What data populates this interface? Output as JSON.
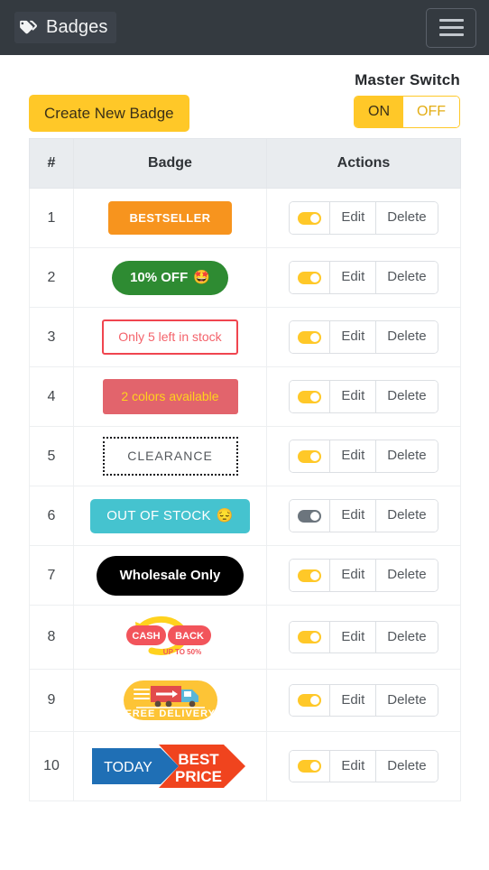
{
  "navbar": {
    "brand_label": "Badges",
    "brand_icon": "tags-icon",
    "menu_icon": "hamburger-icon",
    "background": "#343a40"
  },
  "toolbar": {
    "create_label": "Create New Badge",
    "create_color": "#ffc828",
    "master_switch_label": "Master Switch",
    "master_on_label": "ON",
    "master_off_label": "OFF",
    "master_state": "ON"
  },
  "table": {
    "headers": {
      "number": "#",
      "badge": "Badge",
      "actions": "Actions"
    },
    "action_labels": {
      "edit": "Edit",
      "delete": "Delete"
    },
    "rows": [
      {
        "index": "1",
        "badge_text": "BESTSELLER",
        "badge_type": "bestseller",
        "badge_bg": "#f7941e",
        "badge_fg": "#ffffff",
        "emoji": "",
        "toggle": "on"
      },
      {
        "index": "2",
        "badge_text": "10% OFF",
        "badge_type": "discount",
        "badge_bg": "#2e8b32",
        "badge_fg": "#ffffff",
        "emoji": "🤩",
        "toggle": "on"
      },
      {
        "index": "3",
        "badge_text": "Only 5 left in stock",
        "badge_type": "stock",
        "badge_bg": "#ffffff",
        "badge_fg": "#f4636b",
        "emoji": "",
        "toggle": "on"
      },
      {
        "index": "4",
        "badge_text": "2 colors available",
        "badge_type": "colors",
        "badge_bg": "#e2646c",
        "badge_fg": "#ffd21e",
        "emoji": "",
        "toggle": "on"
      },
      {
        "index": "5",
        "badge_text": "CLEARANCE",
        "badge_type": "clearance",
        "badge_bg": "#ffffff",
        "badge_fg": "#55595d",
        "emoji": "",
        "toggle": "on"
      },
      {
        "index": "6",
        "badge_text": "OUT OF STOCK",
        "badge_type": "oos",
        "badge_bg": "#45c3cf",
        "badge_fg": "#ffffff",
        "emoji": "😔",
        "toggle": "off"
      },
      {
        "index": "7",
        "badge_text": "Wholesale Only",
        "badge_type": "wholesale",
        "badge_bg": "#000000",
        "badge_fg": "#ffffff",
        "emoji": "",
        "toggle": "on"
      },
      {
        "index": "8",
        "badge_text": "CASH BACK",
        "badge_sub": "UP TO 50%",
        "badge_type": "cashback-image",
        "badge_bg": "#f2545b",
        "badge_fg": "#ffffff",
        "emoji": "",
        "toggle": "on"
      },
      {
        "index": "9",
        "badge_text": "FREE DELIVERY",
        "badge_type": "delivery-image",
        "badge_bg": "#fdc436",
        "badge_fg": "#ffffff",
        "emoji": "",
        "toggle": "on"
      },
      {
        "index": "10",
        "badge_text": "TODAY",
        "badge_text2": "BEST",
        "badge_text3": "PRICE",
        "badge_type": "bestprice-image",
        "badge_bg": "#f0441e",
        "badge_fg": "#ffffff",
        "emoji": "",
        "toggle": "on"
      }
    ]
  }
}
